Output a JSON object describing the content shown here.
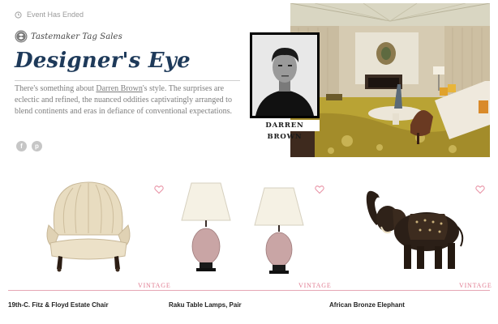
{
  "header": {
    "status": "Event Has Ended",
    "brand": "Tastemaker Tag Sales"
  },
  "event": {
    "title": "Designer's Eye",
    "desc_part1": "There's something about ",
    "designer_link": "Darren Brown",
    "desc_part2": "'s style. The surprises are eclectic and refined, the nuanced oddities captivatingly arranged to blend continents and eras in defiance of conventional expectations.",
    "portrait_name": "DARREN BROWN"
  },
  "social": {
    "facebook": "f",
    "pinterest": "p"
  },
  "products": [
    {
      "name": "19th-C. Fitz & Floyd Estate Chair",
      "tag": "VINTAGE"
    },
    {
      "name": "Raku Table Lamps, Pair",
      "tag": "VINTAGE"
    },
    {
      "name": "African Bronze Elephant",
      "tag": "VINTAGE"
    }
  ],
  "colors": {
    "title": "#1e3a5a",
    "accent_pink": "#e07a90",
    "muted_text": "#7d7d7d"
  }
}
